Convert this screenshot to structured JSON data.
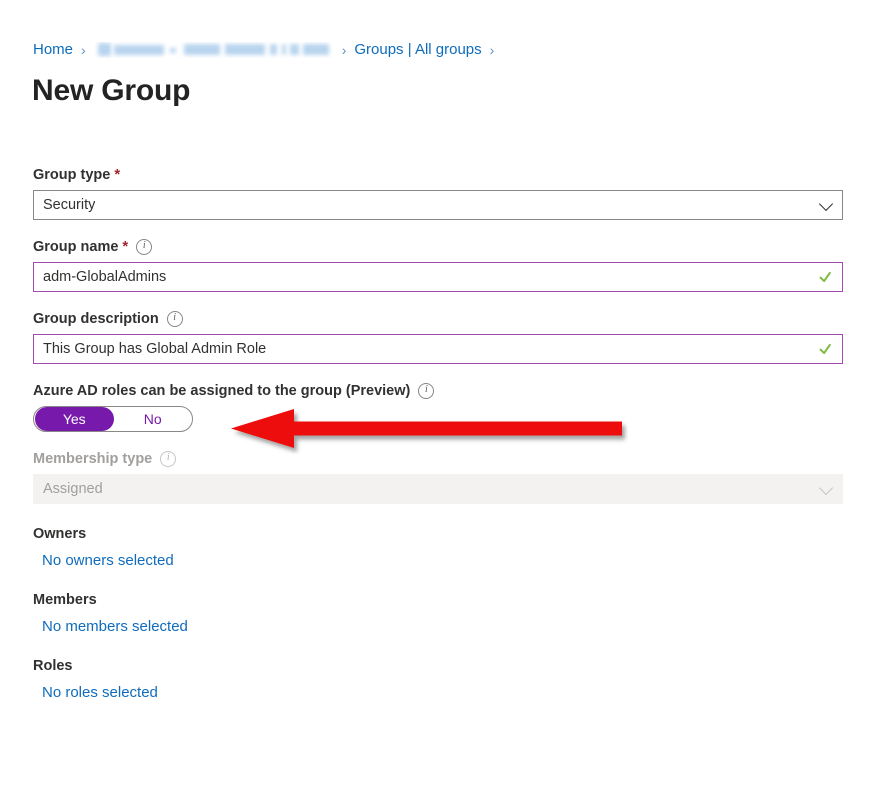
{
  "breadcrumb": {
    "home": "Home",
    "redacted_tenant": "",
    "groups": "Groups | All groups",
    "separator": "›"
  },
  "page_title": "New Group",
  "form": {
    "group_type": {
      "label": "Group type",
      "required": true,
      "value": "Security",
      "icon": "chevron-down-icon"
    },
    "group_name": {
      "label": "Group name",
      "required": true,
      "value": "adm-GlobalAdmins",
      "info_icon": "info-icon",
      "validation_icon": "checkmark-icon"
    },
    "group_description": {
      "label": "Group description",
      "value": "This Group has Global Admin Role",
      "info_icon": "info-icon",
      "validation_icon": "checkmark-icon"
    },
    "azure_ad_roles": {
      "label": "Azure AD roles can be assigned to the group (Preview)",
      "info_icon": "info-icon",
      "option_yes": "Yes",
      "option_no": "No",
      "selected": "Yes"
    },
    "membership_type": {
      "label": "Membership type",
      "value": "Assigned",
      "disabled": true,
      "info_icon": "info-icon",
      "icon": "chevron-down-icon"
    }
  },
  "sections": [
    {
      "title": "Owners",
      "link": "No owners selected"
    },
    {
      "title": "Members",
      "link": "No members selected"
    },
    {
      "title": "Roles",
      "link": "No roles selected"
    }
  ],
  "annotation": {
    "type": "arrow-left",
    "color": "#ee1111"
  },
  "colors": {
    "link": "#0f6cbd",
    "accent_purple": "#7719aa",
    "valid_border": "#a34ab0",
    "check_green": "#7fba42",
    "required_star": "#a4262c",
    "annotation_red": "#ee1111"
  }
}
